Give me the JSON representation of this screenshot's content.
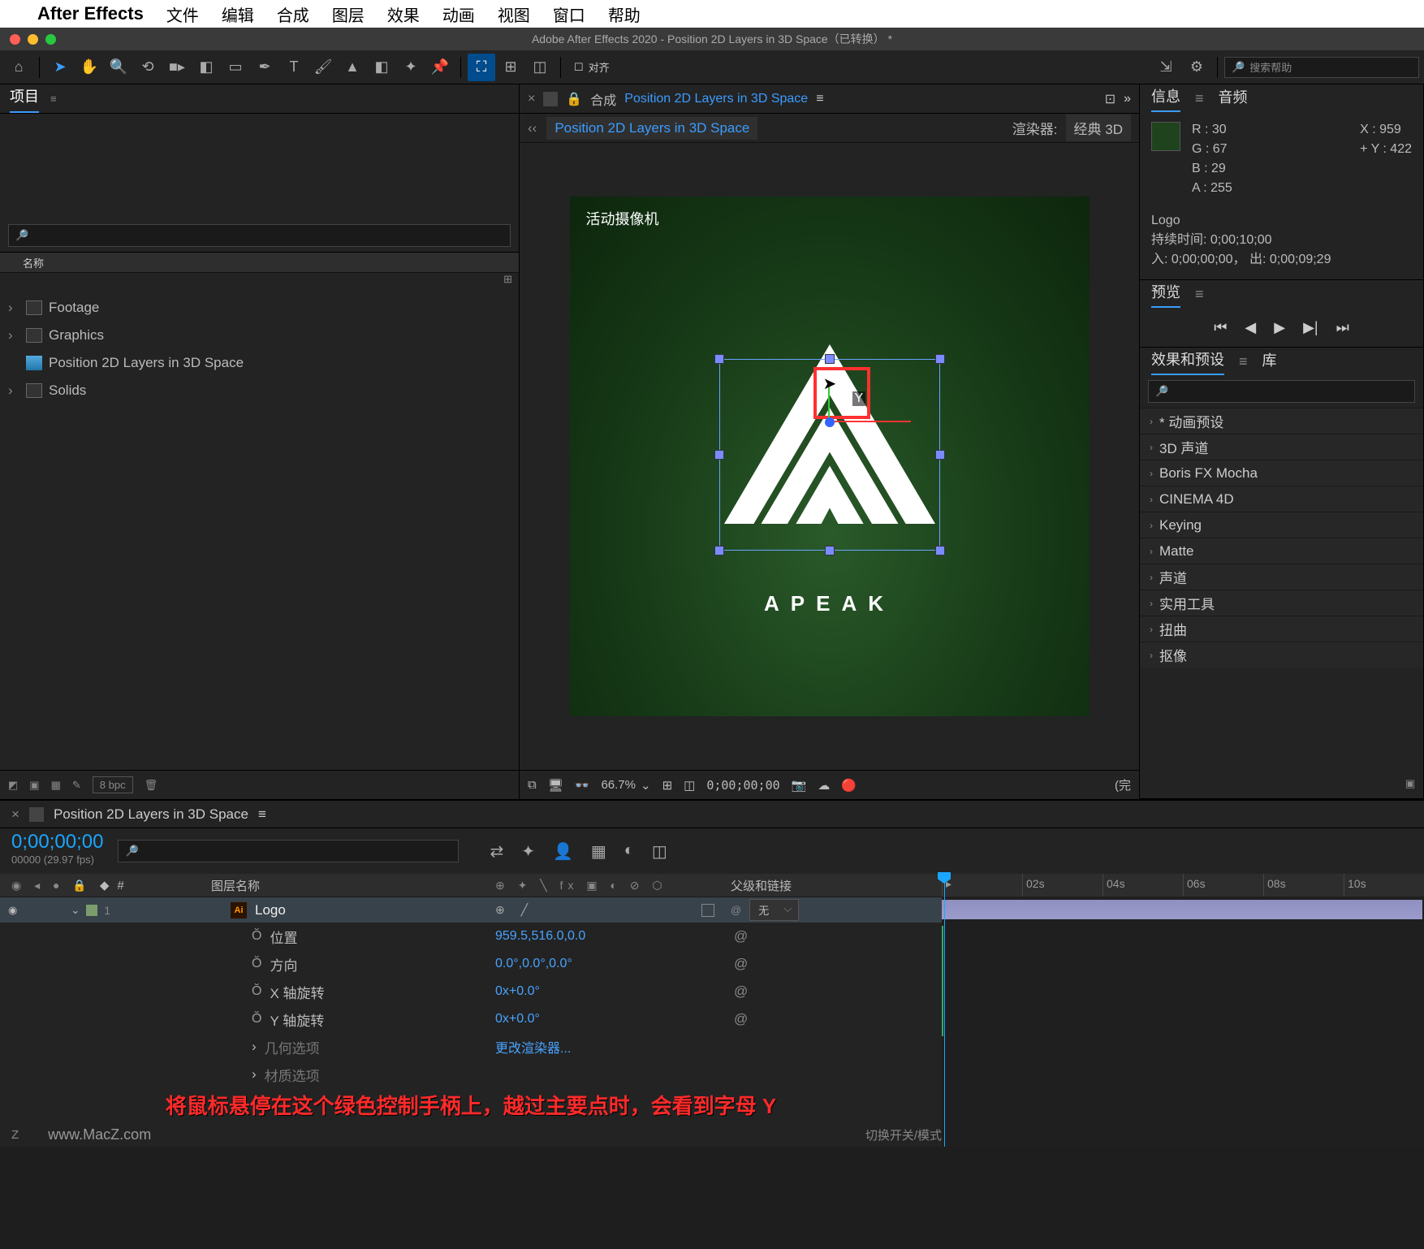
{
  "mac_menu": {
    "app": "After Effects",
    "items": [
      "文件",
      "编辑",
      "合成",
      "图层",
      "效果",
      "动画",
      "视图",
      "窗口",
      "帮助"
    ]
  },
  "window_title": "Adobe After Effects 2020 - Position 2D Layers in 3D Space（已转换） *",
  "toolbar": {
    "align_label": "对齐",
    "search_placeholder": "搜索帮助"
  },
  "project": {
    "tab": "项目",
    "col_name": "名称",
    "items": [
      {
        "type": "folder",
        "label": "Footage"
      },
      {
        "type": "folder",
        "label": "Graphics"
      },
      {
        "type": "comp",
        "label": "Position 2D Layers in 3D Space"
      },
      {
        "type": "folder",
        "label": "Solids"
      }
    ],
    "bpc": "8 bpc"
  },
  "comp": {
    "section": "合成",
    "name": "Position 2D Layers in 3D Space",
    "flowchart_name": "Position 2D Layers in 3D Space",
    "renderer_label": "渲染器:",
    "renderer_value": "经典 3D",
    "camera_label": "活动摄像机",
    "logo_text": "APEAK",
    "zoom": "66.7%",
    "timecode": "0;00;00;00",
    "full": "(完"
  },
  "info": {
    "tab": "信息",
    "tab2": "音频",
    "r": "R :  30",
    "g": "G :  67",
    "b": "B :  29",
    "a": "A :  255",
    "x": "X : 959",
    "y": "Y :  422",
    "layer": "Logo",
    "dur_label": "持续时间: 0;00;10;00",
    "inout": "入: 0;00;00;00， 出: 0;00;09;29"
  },
  "preview": {
    "tab": "预览"
  },
  "effects": {
    "tab": "效果和预设",
    "tab2": "库",
    "presets": [
      "* 动画预设",
      "3D 声道",
      "Boris FX Mocha",
      "CINEMA 4D",
      "Keying",
      "Matte",
      "声道",
      "实用工具",
      "扭曲",
      "抠像"
    ]
  },
  "timeline": {
    "tab": "Position 2D Layers in 3D Space",
    "time": "0;00;00;00",
    "fps": "00000 (29.97 fps)",
    "col_num": "#",
    "col_name": "图层名称",
    "col_parent": "父级和链接",
    "layer": {
      "num": "1",
      "name": "Logo",
      "parent": "无"
    },
    "props": [
      {
        "name": "位置",
        "stopwatch": true,
        "value": "959.5,516.0,0.0"
      },
      {
        "name": "方向",
        "stopwatch": true,
        "value": "0.0°,0.0°,0.0°"
      },
      {
        "name": "X 轴旋转",
        "stopwatch": true,
        "value": "0x+0.0°"
      },
      {
        "name": "Y 轴旋转",
        "stopwatch": true,
        "value": "0x+0.0°"
      },
      {
        "name": "几何选项",
        "stopwatch": false,
        "value": "更改渲染器..."
      },
      {
        "name": "材质选项",
        "stopwatch": false,
        "value": ""
      }
    ],
    "footer": "切换开关/模式",
    "ruler": [
      "02s",
      "04s",
      "06s",
      "08s",
      "10s"
    ]
  },
  "caption": "将鼠标悬停在这个绿色控制手柄上，越过主要点时，会看到字母 Y",
  "watermark": "www.MacZ.com"
}
